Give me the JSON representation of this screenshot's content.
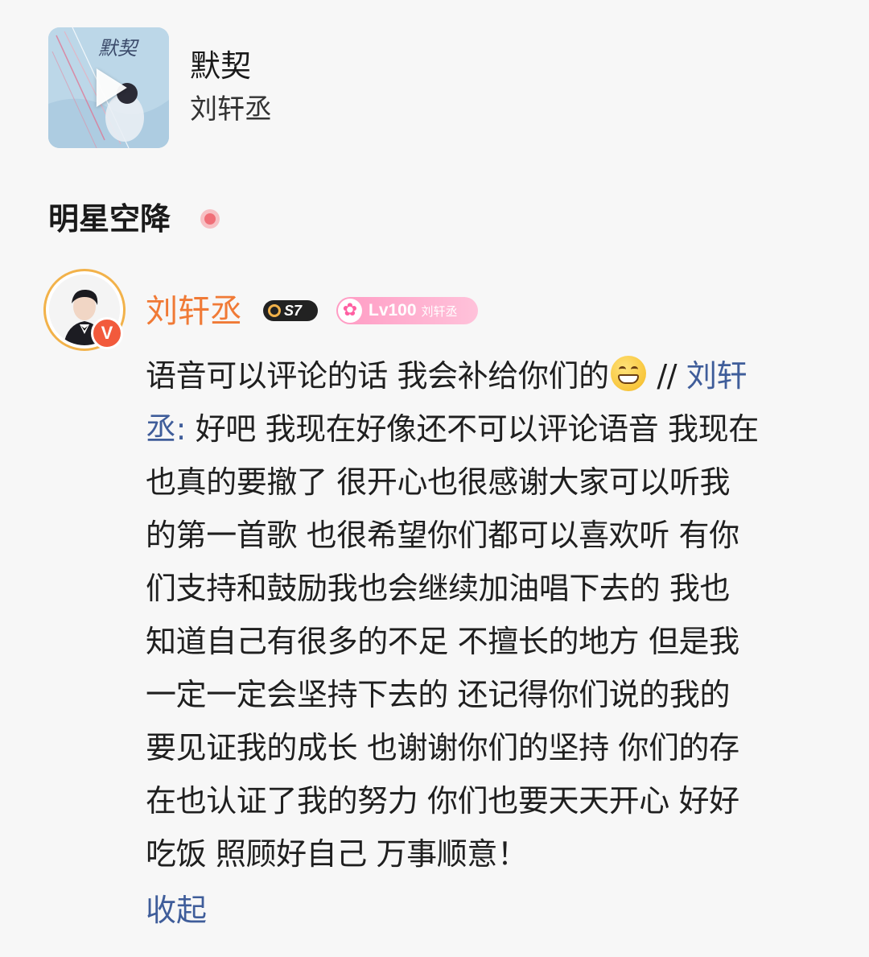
{
  "song": {
    "title": "默契",
    "artist": "刘轩丞",
    "cover_icon": "play-icon"
  },
  "section": {
    "title": "明星空降",
    "live_indicator_color": "#f06f78"
  },
  "comment": {
    "username": "刘轩丞",
    "verified_mark": "V",
    "level_badge": "S7",
    "fan_badge": {
      "level": "Lv100",
      "name": "刘轩丞"
    },
    "lines": [
      {
        "pre": "语音可以评论的话 我会补给你们的",
        "emoji": "grinning-face",
        "post": " // ",
        "link": "刘轩"
      },
      {
        "link": "丞:",
        "post": " 好吧 我现在好像还不可以评论语音 我现在"
      },
      {
        "text": "也真的要撤了 很开心也很感谢大家可以听我"
      },
      {
        "text": "的第一首歌 也很希望你们都可以喜欢听 有你"
      },
      {
        "text": "们支持和鼓励我也会继续加油唱下去的 我也"
      },
      {
        "text": "知道自己有很多的不足 不擅长的地方 但是我"
      },
      {
        "text": "一定一定会坚持下去的 还记得你们说的我的"
      },
      {
        "text": "要见证我的成长 也谢谢你们的坚持 你们的存"
      },
      {
        "text": "在也认证了我的努力 你们也要天天开心 好好"
      },
      {
        "text": "吃饭 照顾好自己 万事顺意！"
      }
    ],
    "collapse_label": "收起"
  },
  "colors": {
    "username": "#f07a36",
    "link": "#3f5d9a",
    "verified": "#f25a3c",
    "fan_badge": "#ff9cc4"
  }
}
